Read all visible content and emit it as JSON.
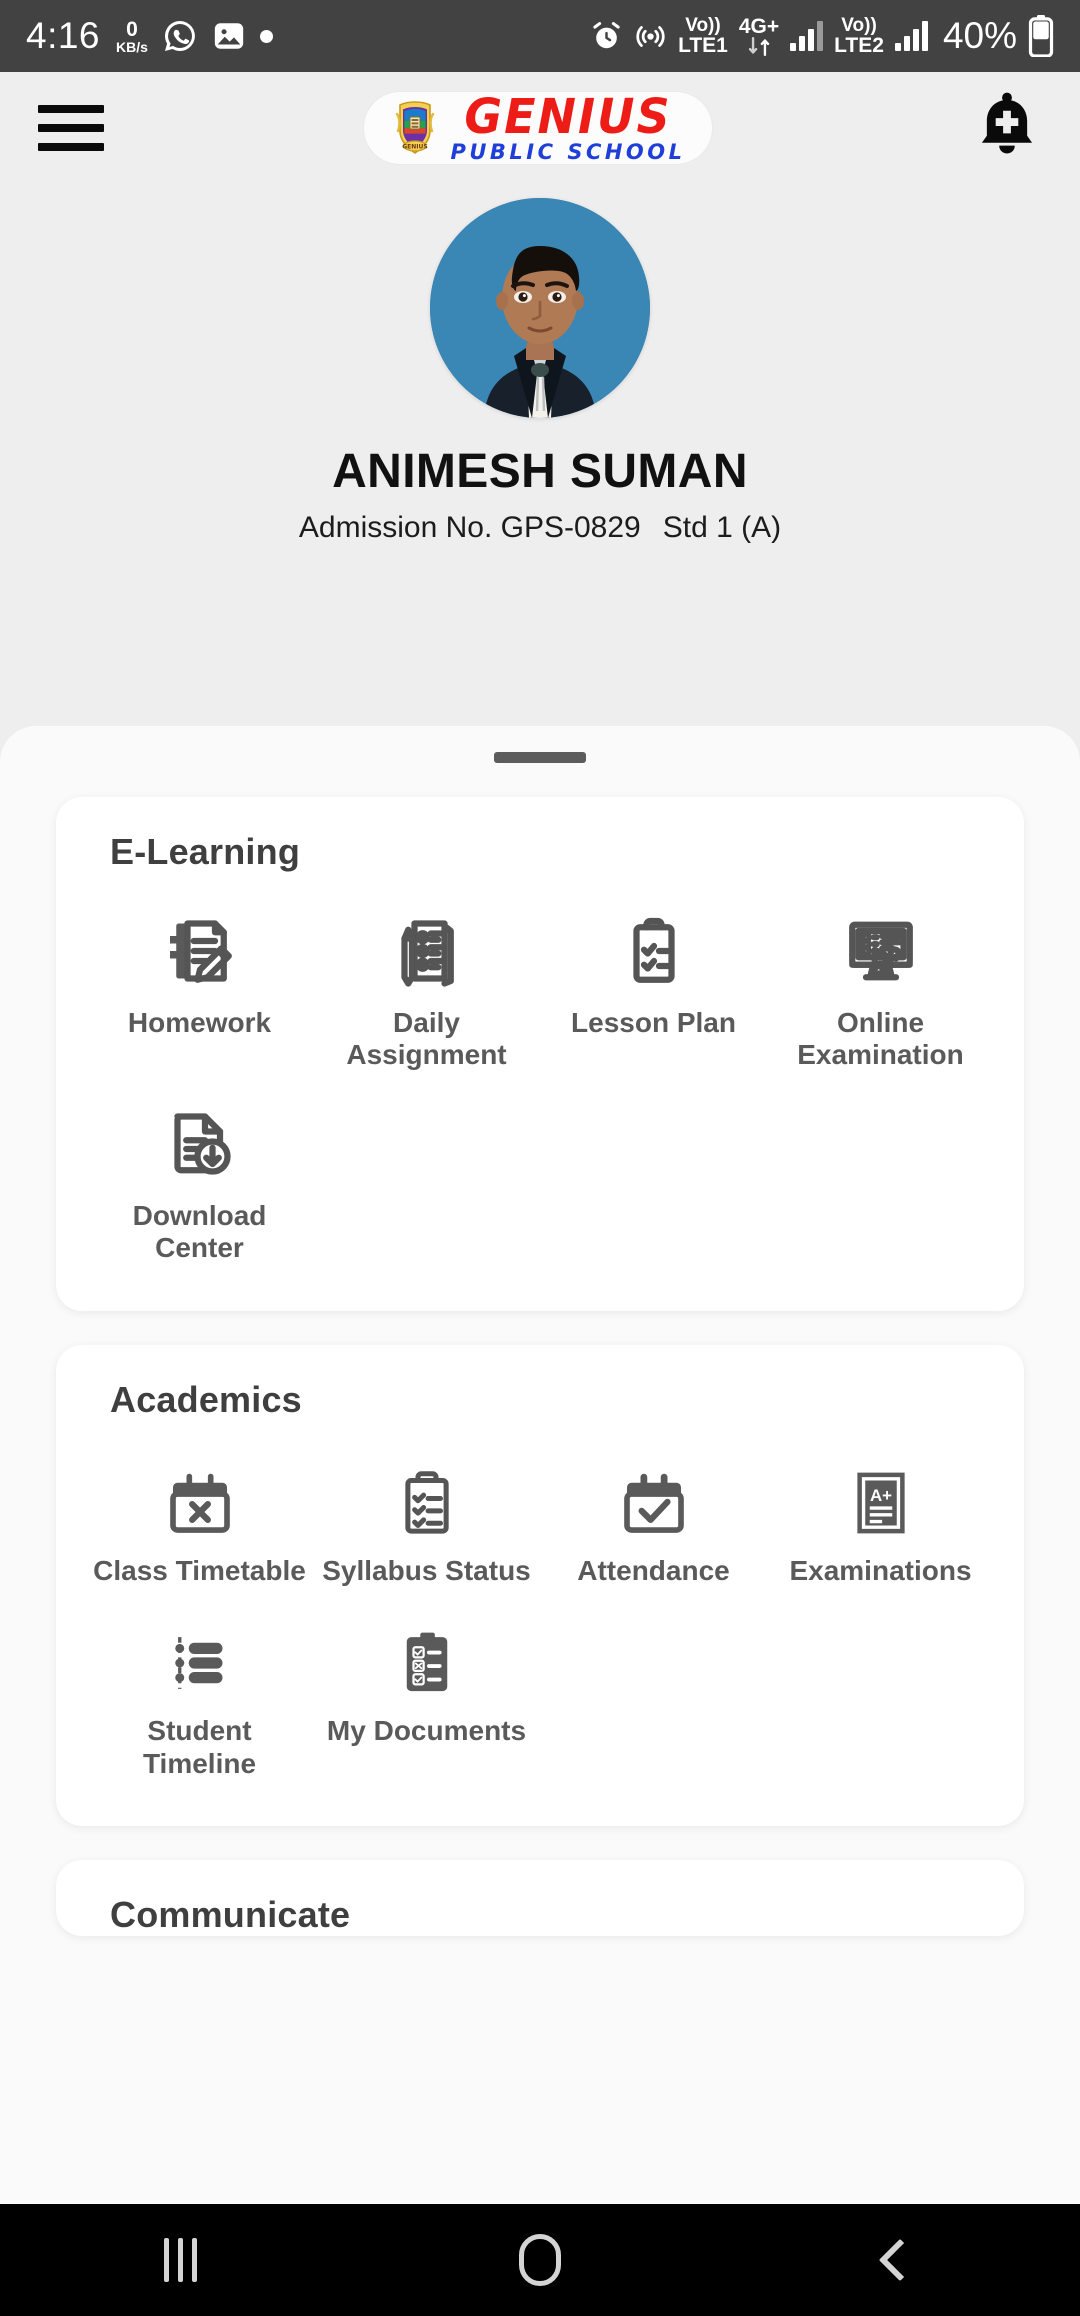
{
  "status_bar": {
    "time": "4:16",
    "network_speed_value": "0",
    "network_speed_unit": "KB/s",
    "icons_left": [
      "whatsapp-icon",
      "gallery-icon",
      "dot-icon"
    ],
    "alarm_icon": "alarm-icon",
    "hotspot_icon": "hotspot-icon",
    "volte1_line1": "Vo))",
    "volte1_line2": "LTE1",
    "data_type": "4G+",
    "volte2_line1": "Vo))",
    "volte2_line2": "LTE2",
    "battery_percent": "40%"
  },
  "app_bar": {
    "menu_icon": "hamburger-menu-icon",
    "notification_icon": "bell-add-icon",
    "logo": {
      "primary": "GENIUS",
      "secondary": "PUBLIC SCHOOL",
      "crest_icon": "school-crest-icon",
      "primary_color": "#ed1c16",
      "secondary_color": "#1f3fd8"
    }
  },
  "profile": {
    "avatar_name": "student-photo",
    "student_name": "ANIMESH SUMAN",
    "admission_label": "Admission No. GPS-0829",
    "class_label": "Std 1 (A)"
  },
  "sections": [
    {
      "title": "E-Learning",
      "items": [
        {
          "label": "Homework",
          "icon": "notebook-pencil-icon"
        },
        {
          "label": "Daily Assignment",
          "icon": "checklist-pencil-icon"
        },
        {
          "label": "Lesson Plan",
          "icon": "clipboard-check-icon"
        },
        {
          "label": "Online Examination",
          "icon": "monitor-quiz-icon"
        },
        {
          "label": "Download Center",
          "icon": "document-download-icon"
        }
      ]
    },
    {
      "title": "Academics",
      "items": [
        {
          "label": "Class Timetable",
          "icon": "calendar-x-icon"
        },
        {
          "label": "Syllabus Status",
          "icon": "clipboard-checklist-icon"
        },
        {
          "label": "Attendance",
          "icon": "calendar-check-icon"
        },
        {
          "label": "Examinations",
          "icon": "grade-sheet-icon"
        },
        {
          "label": "Student Timeline",
          "icon": "timeline-icon"
        },
        {
          "label": "My Documents",
          "icon": "clipboard-documents-icon"
        }
      ]
    },
    {
      "title": "Communicate",
      "items": []
    }
  ],
  "nav_bar": {
    "recents_icon": "recents-icon",
    "home_icon": "home-icon",
    "back_icon": "back-icon"
  }
}
